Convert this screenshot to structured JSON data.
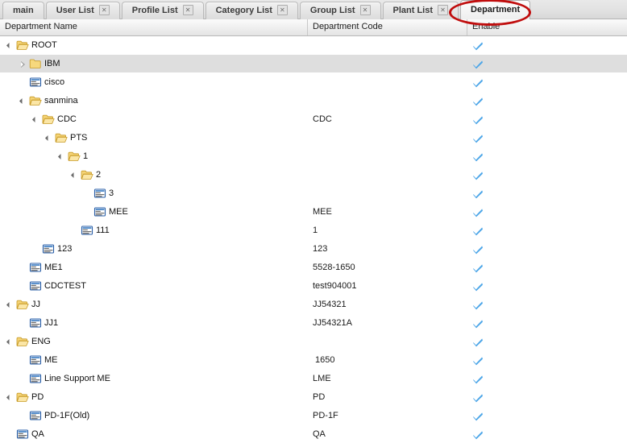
{
  "tabs": [
    {
      "label": "main",
      "closable": false,
      "active": false
    },
    {
      "label": "User List",
      "closable": true,
      "active": false
    },
    {
      "label": "Profile List",
      "closable": true,
      "active": false
    },
    {
      "label": "Category List",
      "closable": true,
      "active": false
    },
    {
      "label": "Group List",
      "closable": true,
      "active": false
    },
    {
      "label": "Plant List",
      "closable": true,
      "active": false
    },
    {
      "label": "Department",
      "closable": false,
      "active": true
    }
  ],
  "tab_close_glyph": "✕",
  "columns": {
    "name": "Department Name",
    "code": "Department Code",
    "enable": "Enable"
  },
  "colors": {
    "accent_check": "#4da6e8",
    "annotation": "#c00d0d",
    "hover_row": "#dedede",
    "folder": "#f3cd56"
  },
  "annotation": {
    "shape": "ellipse",
    "target": "Department"
  },
  "rows": [
    {
      "name": "ROOT",
      "code": "",
      "depth": 0,
      "type": "folder-open",
      "enable": true,
      "hover": false
    },
    {
      "name": "IBM",
      "code": "",
      "depth": 1,
      "type": "folder-closed",
      "enable": true,
      "hover": true
    },
    {
      "name": "cisco",
      "code": "",
      "depth": 1,
      "type": "leaf",
      "enable": true,
      "hover": false
    },
    {
      "name": "sanmina",
      "code": "",
      "depth": 1,
      "type": "folder-open",
      "enable": true,
      "hover": false
    },
    {
      "name": "CDC",
      "code": "CDC",
      "depth": 2,
      "type": "folder-open",
      "enable": true,
      "hover": false
    },
    {
      "name": "PTS",
      "code": "",
      "depth": 3,
      "type": "folder-open",
      "enable": true,
      "hover": false
    },
    {
      "name": "1",
      "code": "",
      "depth": 4,
      "type": "folder-open",
      "enable": true,
      "hover": false
    },
    {
      "name": "2",
      "code": "",
      "depth": 5,
      "type": "folder-open",
      "enable": true,
      "hover": false
    },
    {
      "name": "3",
      "code": "",
      "depth": 6,
      "type": "leaf",
      "enable": true,
      "hover": false
    },
    {
      "name": "MEE",
      "code": "MEE",
      "depth": 6,
      "type": "leaf",
      "enable": true,
      "hover": false
    },
    {
      "name": "111",
      "code": "1",
      "depth": 5,
      "type": "leaf",
      "enable": true,
      "hover": false
    },
    {
      "name": "123",
      "code": "123",
      "depth": 2,
      "type": "leaf",
      "enable": true,
      "hover": false
    },
    {
      "name": "ME1",
      "code": "5528-1650",
      "depth": 1,
      "type": "leaf",
      "enable": true,
      "hover": false
    },
    {
      "name": "CDCTEST",
      "code": "test904001",
      "depth": 1,
      "type": "leaf",
      "enable": true,
      "hover": false
    },
    {
      "name": "JJ",
      "code": "JJ54321",
      "depth": 0,
      "type": "folder-open",
      "enable": true,
      "hover": false
    },
    {
      "name": "JJ1",
      "code": "JJ54321A",
      "depth": 1,
      "type": "leaf",
      "enable": true,
      "hover": false
    },
    {
      "name": "ENG",
      "code": "",
      "depth": 0,
      "type": "folder-open",
      "enable": true,
      "hover": false
    },
    {
      "name": "ME",
      "code": "1650",
      "depth": 1,
      "type": "leaf",
      "enable": true,
      "hover": false
    },
    {
      "name": "Line Support ME",
      "code": "LME",
      "depth": 1,
      "type": "leaf",
      "enable": true,
      "hover": false
    },
    {
      "name": "PD",
      "code": "PD",
      "depth": 0,
      "type": "folder-open",
      "enable": true,
      "hover": false
    },
    {
      "name": "PD-1F(Old)",
      "code": "PD-1F",
      "depth": 1,
      "type": "leaf",
      "enable": true,
      "hover": false
    },
    {
      "name": "QA",
      "code": "QA",
      "depth": 0,
      "type": "leaf",
      "enable": true,
      "hover": false
    }
  ]
}
